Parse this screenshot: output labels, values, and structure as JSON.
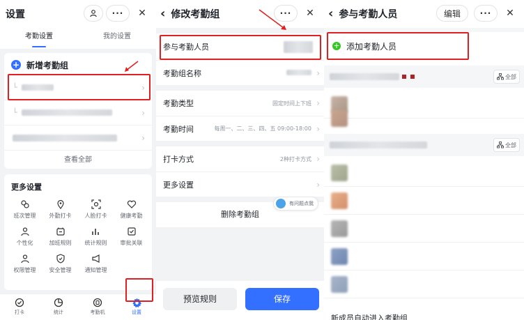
{
  "colors": {
    "accent": "#3370ff",
    "highlight": "#e02020",
    "add_green": "#34c724"
  },
  "panel1": {
    "title": "设置",
    "tabs": [
      "考勤设置",
      "我的设置"
    ],
    "new_group_label": "新增考勤组",
    "view_all": "查看全部",
    "more_title": "更多设置",
    "grid": [
      {
        "label": "班次管理",
        "icon": "shift-icon"
      },
      {
        "label": "外勤打卡",
        "icon": "location-icon"
      },
      {
        "label": "人脸打卡",
        "icon": "face-scan-icon"
      },
      {
        "label": "健康考勤",
        "icon": "heart-icon"
      },
      {
        "label": "个性化",
        "icon": "person-icon"
      },
      {
        "label": "加班规则",
        "icon": "overtime-icon"
      },
      {
        "label": "统计规则",
        "icon": "stats-icon"
      },
      {
        "label": "审批关联",
        "icon": "approval-icon"
      },
      {
        "label": "权限管理",
        "icon": "permission-icon"
      },
      {
        "label": "安全管理",
        "icon": "shield-icon"
      },
      {
        "label": "通知管理",
        "icon": "megaphone-icon"
      }
    ],
    "nav": [
      {
        "label": "打卡",
        "icon": "checkin-icon"
      },
      {
        "label": "统计",
        "icon": "chart-icon"
      },
      {
        "label": "考勤机",
        "icon": "device-icon"
      },
      {
        "label": "设置",
        "icon": "gear-icon"
      }
    ]
  },
  "panel2": {
    "title": "修改考勤组",
    "rows": {
      "members": "参与考勤人员",
      "group_name": "考勤组名称",
      "type": "考勤类型",
      "type_value": "固定时间上下班",
      "time": "考勤时间",
      "time_value": "每周一、二、三、四、五 09:00-18:00",
      "punch": "打卡方式",
      "punch_value": "2种打卡方式",
      "more": "更多设置"
    },
    "help": "有问题点我",
    "delete": "删除考勤组",
    "preview": "预览规则",
    "save": "保存"
  },
  "panel3": {
    "title": "参与考勤人员",
    "edit": "编辑",
    "add": "添加考勤人员",
    "all": "全部",
    "last_row": "新成员自动进入考勤组"
  }
}
